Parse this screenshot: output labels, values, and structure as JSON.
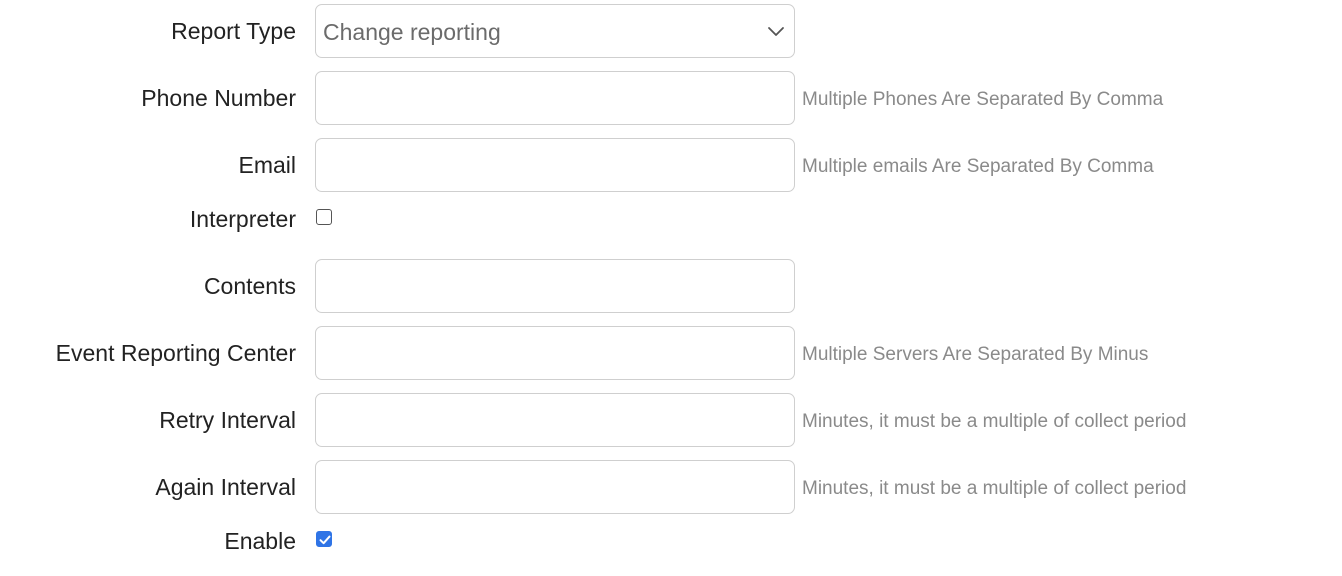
{
  "form": {
    "report_type": {
      "label": "Report Type",
      "value": "Change reporting"
    },
    "phone_number": {
      "label": "Phone Number",
      "value": "",
      "hint": "Multiple Phones Are Separated By Comma"
    },
    "email": {
      "label": "Email",
      "value": "",
      "hint": "Multiple emails Are Separated By Comma"
    },
    "interpreter": {
      "label": "Interpreter",
      "checked": false
    },
    "contents": {
      "label": "Contents",
      "value": ""
    },
    "event_reporting_center": {
      "label": "Event Reporting Center",
      "value": "",
      "hint": "Multiple Servers Are Separated By Minus"
    },
    "retry_interval": {
      "label": "Retry Interval",
      "value": "",
      "hint": "Minutes, it must be a multiple of collect period"
    },
    "again_interval": {
      "label": "Again Interval",
      "value": "",
      "hint": "Minutes, it must be a multiple of collect period"
    },
    "enable": {
      "label": "Enable",
      "checked": true
    }
  },
  "colors": {
    "checkbox_checked": "#2f74e6",
    "hint_text": "#8a8a8a",
    "input_border": "#cfcfcf"
  }
}
